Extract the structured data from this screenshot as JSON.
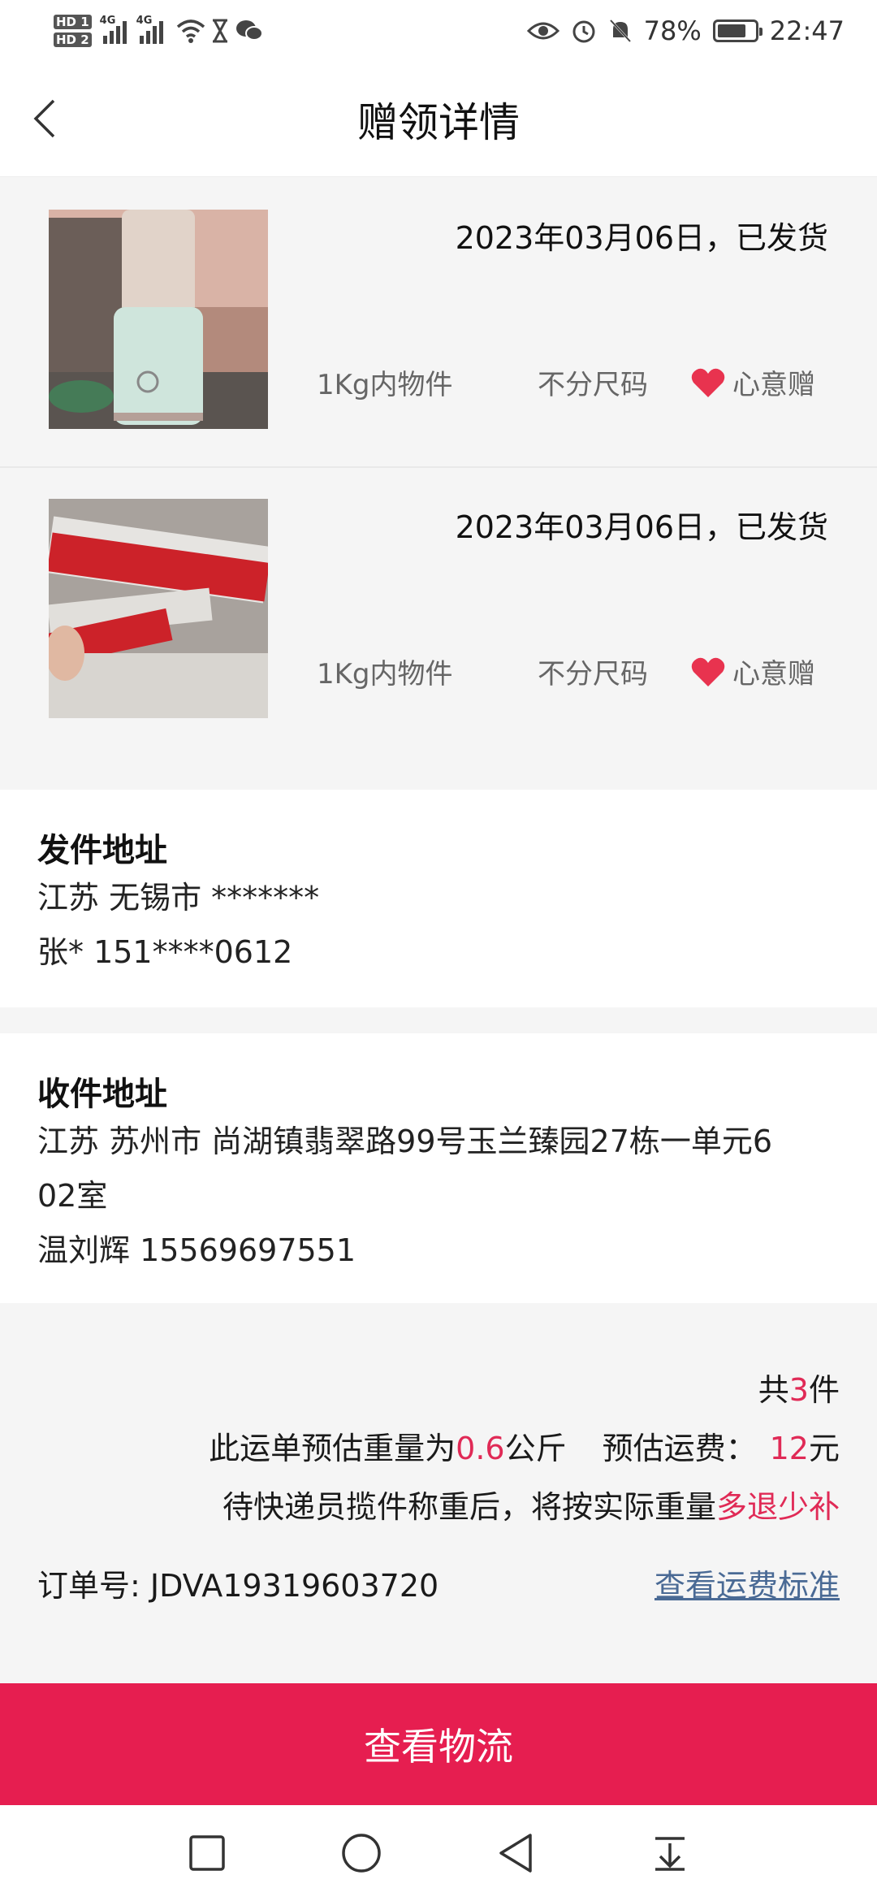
{
  "status_bar": {
    "sim1": "HD 1",
    "sim2": "HD 2",
    "net1": "4G",
    "net2": "4G",
    "battery": "78%",
    "time": "22:47",
    "battery_level": 0.78
  },
  "header": {
    "title": "赠领详情"
  },
  "items": [
    {
      "date_status": "2023年03月06日，已发货",
      "weight": "1Kg内物件",
      "size": "不分尺码",
      "type": "心意赠"
    },
    {
      "date_status": "2023年03月06日，已发货",
      "weight": "1Kg内物件",
      "size": "不分尺码",
      "type": "心意赠"
    }
  ],
  "sender": {
    "heading": "发件地址",
    "address": "江苏 无锡市 *******",
    "contact": "张* 151****0612"
  },
  "receiver": {
    "heading": "收件地址",
    "address_line1": "江苏 苏州市 尚湖镇翡翠路99号玉兰臻园27栋一单元6",
    "address_line2": "02室",
    "contact": "温刘辉 15569697551"
  },
  "summary": {
    "count_prefix": "共",
    "count": "3",
    "count_suffix": "件",
    "weight_prefix": "此运单预估重量为",
    "weight_value": "0.6",
    "weight_unit": "公斤",
    "fee_label": "预估运费：",
    "fee_value": "12",
    "fee_unit": "元",
    "note_prefix": "待快递员揽件称重后，将按实际重量",
    "note_highlight": "多退少补",
    "order_label": "订单号: JDVA19319603720",
    "fee_standard_link": "查看运费标准"
  },
  "action": {
    "track_button": "查看物流"
  },
  "colors": {
    "accent": "#e61e50",
    "highlight": "#e02a56",
    "link": "#4a6a95"
  }
}
